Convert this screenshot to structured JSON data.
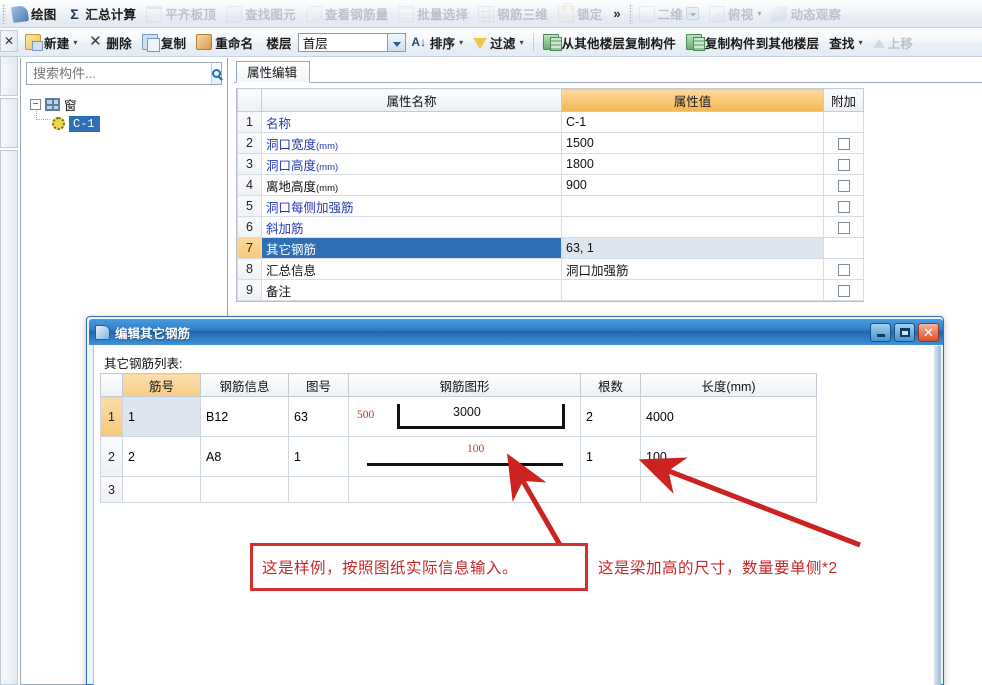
{
  "toolbar_top": {
    "items": [
      {
        "label": "绘图",
        "icon": "draw-icon",
        "dim": false
      },
      {
        "label": "汇总计算",
        "icon": "sigma-icon",
        "dim": false
      },
      {
        "label": "平齐板顶",
        "icon": "slab-icon",
        "dim": true
      },
      {
        "label": "查找图元",
        "icon": "find-element-icon",
        "dim": true
      },
      {
        "label": "查看钢筋量",
        "icon": "view-rebar-icon",
        "dim": true
      },
      {
        "label": "批量选择",
        "icon": "batch-select-icon",
        "dim": true
      },
      {
        "label": "钢筋三维",
        "icon": "rebar-3d-icon",
        "dim": true
      },
      {
        "label": "锁定",
        "icon": "lock-icon",
        "dim": true
      }
    ],
    "overflow_label": "»",
    "view_items": [
      {
        "label": "二维",
        "icon": "2d-view-icon",
        "dim": true,
        "has_dropdown": true
      },
      {
        "label": "俯视",
        "icon": "top-view-icon",
        "dim": true,
        "has_caret": true
      },
      {
        "label": "动态观察",
        "icon": "orbit-icon",
        "dim": true
      }
    ]
  },
  "toolbar_second": {
    "close_glyph": "✕",
    "items": [
      {
        "label": "新建",
        "icon": "new-icon",
        "caret": true,
        "dim": false
      },
      {
        "label": "删除",
        "icon": "delete-icon",
        "caret": false,
        "dim": false
      },
      {
        "label": "复制",
        "icon": "copy-icon",
        "caret": false,
        "dim": false
      },
      {
        "label": "重命名",
        "icon": "rename-icon",
        "caret": false,
        "dim": false
      }
    ],
    "floor_label": "楼层",
    "floor_value": "首层",
    "sort_label": "排序",
    "filter_label": "过滤",
    "copy_from_label": "从其他楼层复制构件",
    "copy_to_label": "复制构件到其他楼层",
    "find_label": "查找",
    "move_up_label": "上移"
  },
  "sidebar": {
    "search_placeholder": "搜索构件...",
    "search_value": "",
    "tree": {
      "root_label": "窗",
      "root_expander": "−",
      "child_label": "C-1"
    }
  },
  "property_panel": {
    "tab_label": "属性编辑",
    "columns": [
      "",
      "属性名称",
      "属性值",
      "附加"
    ],
    "rows": [
      {
        "n": "1",
        "name": "名称",
        "unit": "",
        "value": "C-1",
        "attach": false,
        "selected": false,
        "blue": true
      },
      {
        "n": "2",
        "name": "洞口宽度",
        "unit": "(mm)",
        "value": "1500",
        "attach": true,
        "selected": false,
        "blue": true
      },
      {
        "n": "3",
        "name": "洞口高度",
        "unit": "(mm)",
        "value": "1800",
        "attach": true,
        "selected": false,
        "blue": true
      },
      {
        "n": "4",
        "name": "离地高度",
        "unit": "(mm)",
        "value": "900",
        "attach": true,
        "selected": false,
        "blue": false
      },
      {
        "n": "5",
        "name": "洞口每侧加强筋",
        "unit": "",
        "value": "",
        "attach": true,
        "selected": false,
        "blue": true
      },
      {
        "n": "6",
        "name": "斜加筋",
        "unit": "",
        "value": "",
        "attach": true,
        "selected": false,
        "blue": true
      },
      {
        "n": "7",
        "name": "其它钢筋",
        "unit": "",
        "value": "63, 1",
        "attach": false,
        "selected": true,
        "blue": true
      },
      {
        "n": "8",
        "name": "汇总信息",
        "unit": "",
        "value": "洞口加强筋",
        "attach": true,
        "selected": false,
        "blue": false
      },
      {
        "n": "9",
        "name": "备注",
        "unit": "",
        "value": "",
        "attach": true,
        "selected": false,
        "blue": false
      }
    ]
  },
  "dialog": {
    "title": "编辑其它钢筋",
    "list_label": "其它钢筋列表:",
    "window_buttons": {
      "minimize": "_",
      "maximize": "□",
      "close": "✕"
    },
    "columns": [
      "",
      "筋号",
      "钢筋信息",
      "图号",
      "钢筋图形",
      "根数",
      "长度(mm)"
    ],
    "length_unit": "(mm)",
    "rows": [
      {
        "n": "1",
        "bar_no": "1",
        "bar_info": "B12",
        "fig_no": "63",
        "figure": {
          "type": "u-shape",
          "leg_label": "500",
          "span_label": "3000"
        },
        "count": "2",
        "length": "4000"
      },
      {
        "n": "2",
        "bar_no": "2",
        "bar_info": "A8",
        "fig_no": "1",
        "figure": {
          "type": "straight",
          "span_label": "100"
        },
        "count": "1",
        "length": "100"
      },
      {
        "n": "3",
        "bar_no": "",
        "bar_info": "",
        "fig_no": "",
        "figure": {
          "type": "empty"
        },
        "count": "",
        "length": ""
      }
    ]
  },
  "annotations": {
    "box_text": "这是样例，按照图纸实际信息输入。",
    "note_text": "这是梁加高的尺寸，数量要单侧*2",
    "color": "#c62828",
    "box_border_color": "#d32f2f",
    "arrow_color": "#cc2222"
  }
}
